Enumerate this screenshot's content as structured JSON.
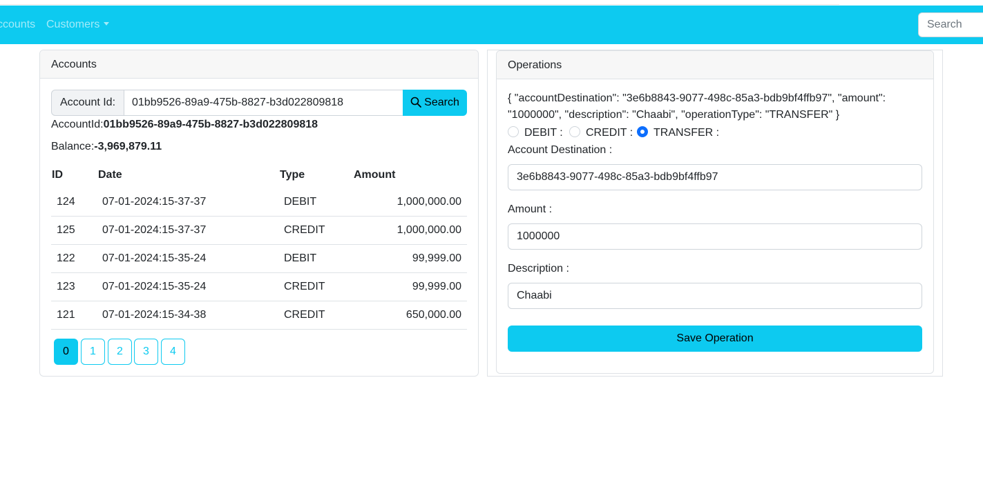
{
  "navbar": {
    "accounts_label": "ccounts",
    "customers_label": "Customers",
    "search_placeholder": "Search"
  },
  "accounts_card": {
    "title": "Accounts",
    "account_id_label": "Account Id:",
    "account_id_value": "01bb9526-89a9-475b-8827-b3d022809818",
    "search_button": "Search",
    "account_id_caption": "AccountId:",
    "account_id_display": "01bb9526-89a9-475b-8827-b3d022809818",
    "balance_caption": "Balance:",
    "balance_value": "-3,969,879.11",
    "table": {
      "headers": [
        "ID",
        "Date",
        "Type",
        "Amount"
      ],
      "rows": [
        {
          "id": "124",
          "date": "07-01-2024:15-37-37",
          "type": "DEBIT",
          "amount": "1,000,000.00"
        },
        {
          "id": "125",
          "date": "07-01-2024:15-37-37",
          "type": "CREDIT",
          "amount": "1,000,000.00"
        },
        {
          "id": "122",
          "date": "07-01-2024:15-35-24",
          "type": "DEBIT",
          "amount": "99,999.00"
        },
        {
          "id": "123",
          "date": "07-01-2024:15-35-24",
          "type": "CREDIT",
          "amount": "99,999.00"
        },
        {
          "id": "121",
          "date": "07-01-2024:15-34-38",
          "type": "CREDIT",
          "amount": "650,000.00"
        }
      ]
    },
    "pages": [
      "0",
      "1",
      "2",
      "3",
      "4"
    ],
    "active_page": "0"
  },
  "operations_card": {
    "title": "Operations",
    "json_preview": "{ \"accountDestination\": \"3e6b8843-9077-498c-85a3-bdb9bf4ffb97\", \"amount\": \"1000000\", \"description\": \"Chaabi\", \"operationType\": \"TRANSFER\" }",
    "radios": [
      {
        "label": "DEBIT :",
        "checked": false
      },
      {
        "label": "CREDIT :",
        "checked": false
      },
      {
        "label": "TRANSFER :",
        "checked": true
      }
    ],
    "destination_label": "Account Destination :",
    "destination_value": "3e6b8843-9077-498c-85a3-bdb9bf4ffb97",
    "amount_label": "Amount :",
    "amount_value": "1000000",
    "description_label": "Description :",
    "description_value": "Chaabi",
    "save_button": "Save Operation"
  },
  "colors": {
    "accent": "#0dcaf0",
    "radio_checked": "#0d6efd"
  }
}
